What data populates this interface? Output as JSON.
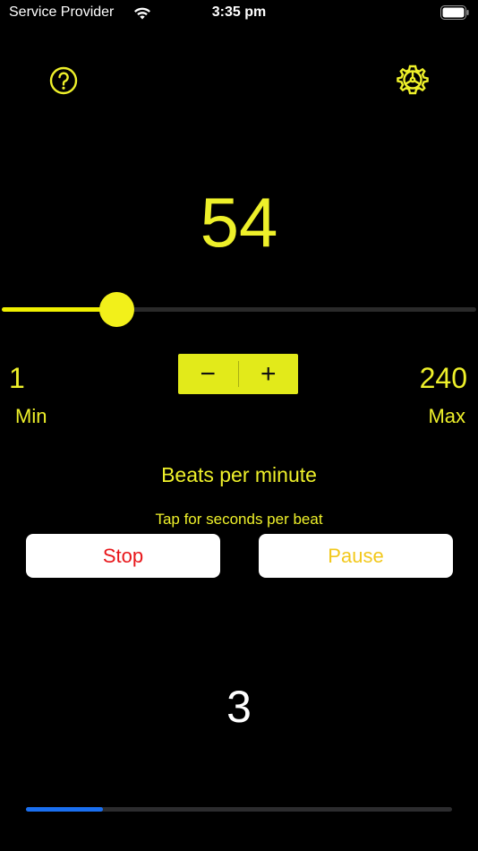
{
  "status_bar": {
    "carrier": "Service Provider",
    "time": "3:35 pm",
    "wifi_icon": "wifi-icon",
    "battery_icon": "battery-icon"
  },
  "toolbar": {
    "help_icon": "question-circle-icon",
    "settings_icon": "gear-icon"
  },
  "tempo": {
    "bpm": "54",
    "min_value": "1",
    "min_label": "Min",
    "max_value": "240",
    "max_label": "Max",
    "slider_value": 54,
    "slider_min": 1,
    "slider_max": 240,
    "decrement_label": "−",
    "increment_label": "+",
    "unit_label": "Beats per minute",
    "tap_label": "Tap for seconds per beat"
  },
  "controls": {
    "stop_label": "Stop",
    "pause_label": "Pause",
    "stop_color": "#e8161a",
    "pause_color": "#f2c81c"
  },
  "beat": {
    "current": "3",
    "progress": 0.18
  },
  "colors": {
    "accent": "#eef02a",
    "background": "#000000",
    "progress": "#1a6ff0"
  }
}
